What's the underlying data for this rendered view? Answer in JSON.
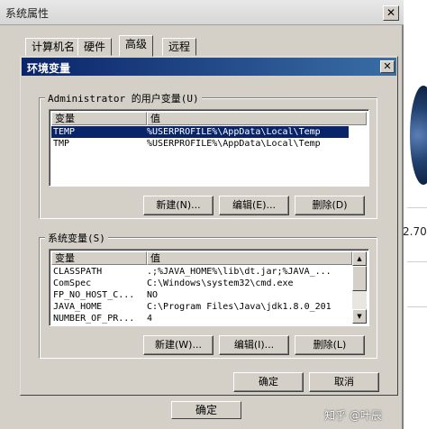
{
  "system_window": {
    "title": "系统属性",
    "close_label": "✕",
    "tabs": [
      {
        "label": "计算机名"
      },
      {
        "label": "硬件"
      },
      {
        "label": "高级"
      },
      {
        "label": "远程"
      }
    ],
    "confirm_label": "确定"
  },
  "right_edge": {
    "text": "2.70"
  },
  "env_dialog": {
    "title": "环境变量",
    "close_label": "✕",
    "user_group": {
      "label": "Administrator 的用户变量(U)",
      "header": {
        "name": "变量",
        "value": "值"
      },
      "rows": [
        {
          "name": "TEMP",
          "value": "%USERPROFILE%\\AppData\\Local\\Temp",
          "selected": true
        },
        {
          "name": "TMP",
          "value": "%USERPROFILE%\\AppData\\Local\\Temp",
          "selected": false
        }
      ],
      "buttons": {
        "new": "新建(N)...",
        "edit": "编辑(E)...",
        "delete": "删除(D)"
      }
    },
    "system_group": {
      "label": "系统变量(S)",
      "header": {
        "name": "变量",
        "value": "值"
      },
      "rows": [
        {
          "name": "CLASSPATH",
          "value": ".;%JAVA_HOME%\\lib\\dt.jar;%JAVA_..."
        },
        {
          "name": "ComSpec",
          "value": "C:\\Windows\\system32\\cmd.exe"
        },
        {
          "name": "FP_NO_HOST_C...",
          "value": "NO"
        },
        {
          "name": "JAVA_HOME",
          "value": "C:\\Program Files\\Java\\jdk1.8.0_201"
        },
        {
          "name": "NUMBER_OF_PR...",
          "value": "4"
        }
      ],
      "scroll_up": "▲",
      "scroll_down": "▼",
      "buttons": {
        "new": "新建(W)...",
        "edit": "编辑(I)...",
        "delete": "删除(L)"
      }
    },
    "footer": {
      "ok": "确定",
      "cancel": "取消"
    }
  },
  "watermark": "知乎 @叶辰"
}
